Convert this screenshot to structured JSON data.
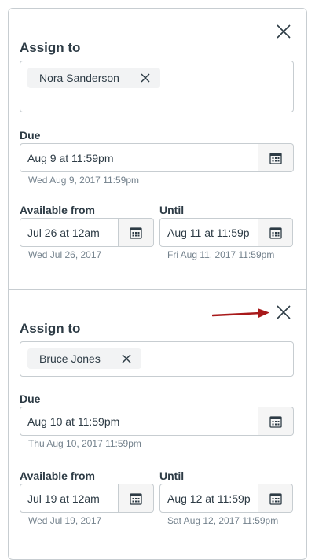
{
  "sections": [
    {
      "assign_heading": "Assign to",
      "assignee": "Nora Sanderson",
      "due_label": "Due",
      "due_value": "Aug 9 at 11:59pm",
      "due_hint": "Wed Aug 9, 2017 11:59pm",
      "available_label": "Available from",
      "available_value": "Jul 26 at 12am",
      "available_hint": "Wed Jul 26, 2017",
      "until_label": "Until",
      "until_value": "Aug 11 at 11:59p",
      "until_hint": "Fri Aug 11, 2017 11:59pm"
    },
    {
      "assign_heading": "Assign to",
      "assignee": "Bruce Jones",
      "due_label": "Due",
      "due_value": "Aug 10 at 11:59pm",
      "due_hint": "Thu Aug 10, 2017 11:59pm",
      "available_label": "Available from",
      "available_value": "Jul 19 at 12am",
      "available_hint": "Wed Jul 19, 2017",
      "until_label": "Until",
      "until_value": "Aug 12 at 11:59p",
      "until_hint": "Sat Aug 12, 2017 11:59pm"
    }
  ],
  "icons": {
    "close": "close-icon",
    "remove": "remove-token-icon",
    "calendar": "calendar-icon",
    "arrow": "arrow-right-icon"
  },
  "colors": {
    "border": "#c7cdd1",
    "text": "#2d3b45",
    "hint": "#73818c",
    "arrow": "#a8191a"
  }
}
